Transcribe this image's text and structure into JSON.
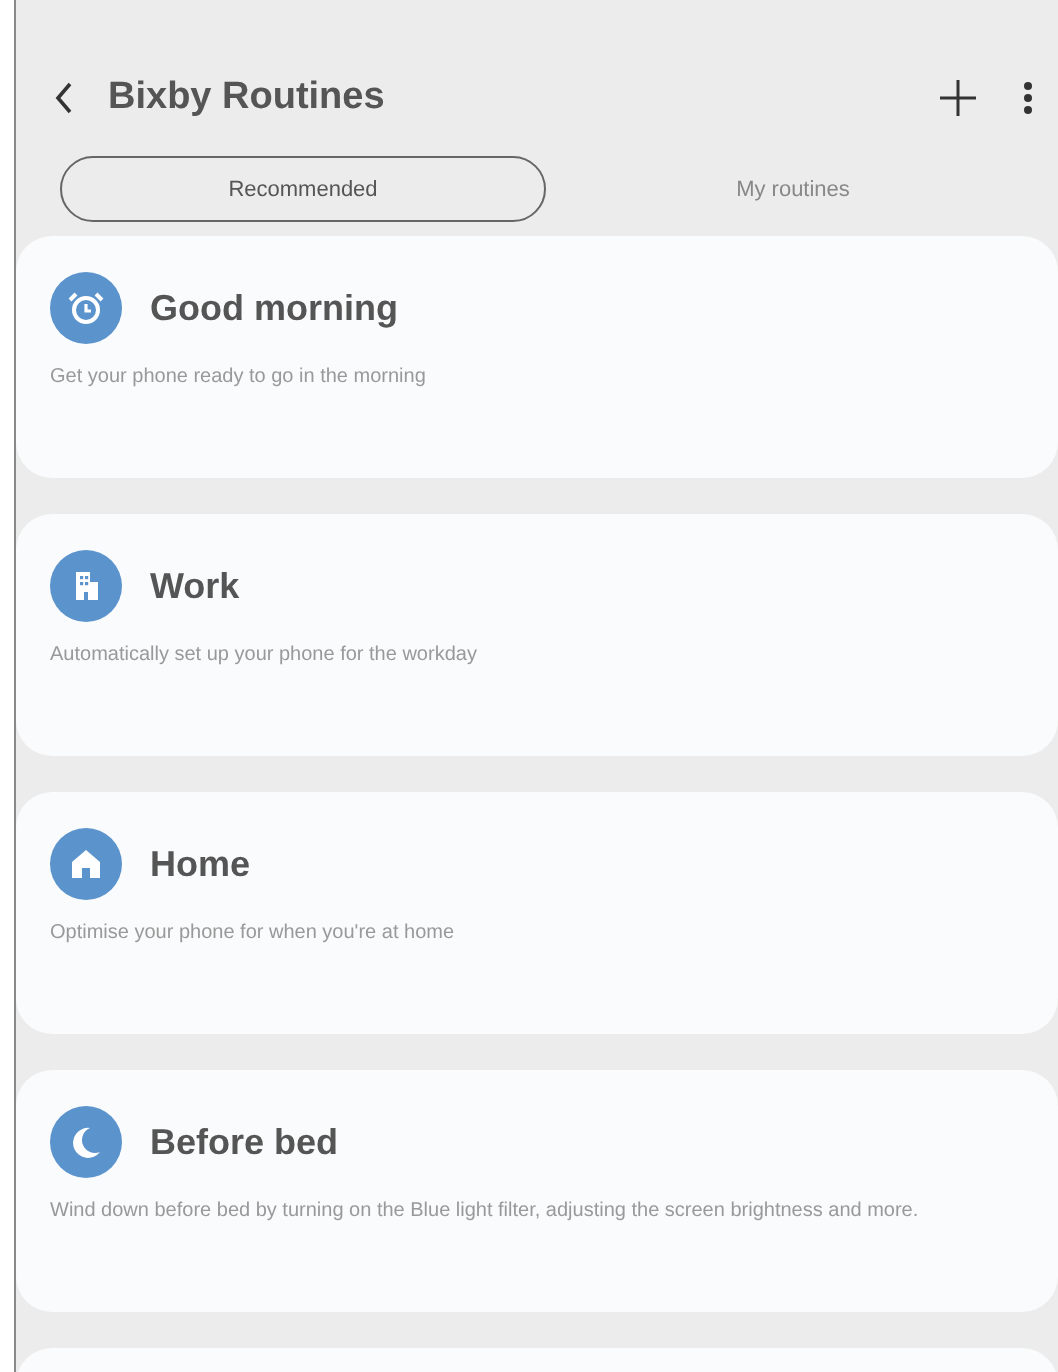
{
  "header": {
    "title": "Bixby Routines"
  },
  "tabs": [
    {
      "label": "Recommended",
      "selected": true
    },
    {
      "label": "My routines",
      "selected": false
    }
  ],
  "routines": [
    {
      "kind": "alarm",
      "name": "Good morning",
      "description": "Get your phone ready to go in the morning"
    },
    {
      "kind": "building",
      "name": "Work",
      "description": "Automatically set up your phone for the workday"
    },
    {
      "kind": "home",
      "name": "Home",
      "description": "Optimise your phone for when you're at home"
    },
    {
      "kind": "moon",
      "name": "Before bed",
      "description": "Wind down before bed by turning on the Blue light filter, adjusting the screen brightness and more."
    }
  ]
}
